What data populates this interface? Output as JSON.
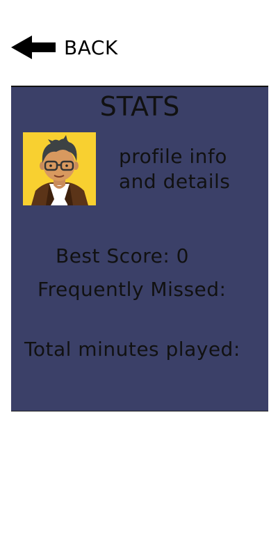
{
  "header": {
    "back_label": "BACK"
  },
  "stats": {
    "title": "STATS",
    "profile_info_line1": "profile info",
    "profile_info_line2": "and details",
    "best_score_label": "Best Score: 0",
    "frequently_missed_label": "Frequently Missed:",
    "total_minutes_label": "Total minutes played:"
  },
  "colors": {
    "panel_background": "#3b4068",
    "avatar_background": "#f8d030",
    "text": "#111111"
  }
}
